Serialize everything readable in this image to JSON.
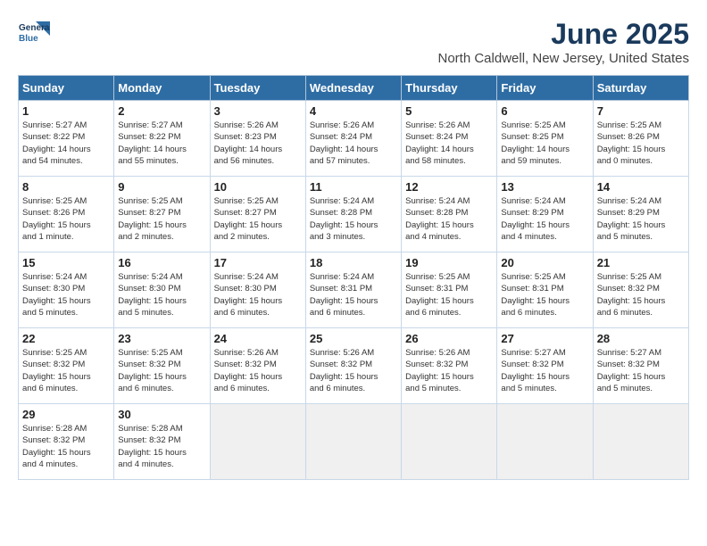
{
  "logo": {
    "line1": "General",
    "line2": "Blue"
  },
  "title": "June 2025",
  "location": "North Caldwell, New Jersey, United States",
  "headers": [
    "Sunday",
    "Monday",
    "Tuesday",
    "Wednesday",
    "Thursday",
    "Friday",
    "Saturday"
  ],
  "weeks": [
    [
      {
        "day": "1",
        "info": "Sunrise: 5:27 AM\nSunset: 8:22 PM\nDaylight: 14 hours\nand 54 minutes."
      },
      {
        "day": "2",
        "info": "Sunrise: 5:27 AM\nSunset: 8:22 PM\nDaylight: 14 hours\nand 55 minutes."
      },
      {
        "day": "3",
        "info": "Sunrise: 5:26 AM\nSunset: 8:23 PM\nDaylight: 14 hours\nand 56 minutes."
      },
      {
        "day": "4",
        "info": "Sunrise: 5:26 AM\nSunset: 8:24 PM\nDaylight: 14 hours\nand 57 minutes."
      },
      {
        "day": "5",
        "info": "Sunrise: 5:26 AM\nSunset: 8:24 PM\nDaylight: 14 hours\nand 58 minutes."
      },
      {
        "day": "6",
        "info": "Sunrise: 5:25 AM\nSunset: 8:25 PM\nDaylight: 14 hours\nand 59 minutes."
      },
      {
        "day": "7",
        "info": "Sunrise: 5:25 AM\nSunset: 8:26 PM\nDaylight: 15 hours\nand 0 minutes."
      }
    ],
    [
      {
        "day": "8",
        "info": "Sunrise: 5:25 AM\nSunset: 8:26 PM\nDaylight: 15 hours\nand 1 minute."
      },
      {
        "day": "9",
        "info": "Sunrise: 5:25 AM\nSunset: 8:27 PM\nDaylight: 15 hours\nand 2 minutes."
      },
      {
        "day": "10",
        "info": "Sunrise: 5:25 AM\nSunset: 8:27 PM\nDaylight: 15 hours\nand 2 minutes."
      },
      {
        "day": "11",
        "info": "Sunrise: 5:24 AM\nSunset: 8:28 PM\nDaylight: 15 hours\nand 3 minutes."
      },
      {
        "day": "12",
        "info": "Sunrise: 5:24 AM\nSunset: 8:28 PM\nDaylight: 15 hours\nand 4 minutes."
      },
      {
        "day": "13",
        "info": "Sunrise: 5:24 AM\nSunset: 8:29 PM\nDaylight: 15 hours\nand 4 minutes."
      },
      {
        "day": "14",
        "info": "Sunrise: 5:24 AM\nSunset: 8:29 PM\nDaylight: 15 hours\nand 5 minutes."
      }
    ],
    [
      {
        "day": "15",
        "info": "Sunrise: 5:24 AM\nSunset: 8:30 PM\nDaylight: 15 hours\nand 5 minutes."
      },
      {
        "day": "16",
        "info": "Sunrise: 5:24 AM\nSunset: 8:30 PM\nDaylight: 15 hours\nand 5 minutes."
      },
      {
        "day": "17",
        "info": "Sunrise: 5:24 AM\nSunset: 8:30 PM\nDaylight: 15 hours\nand 6 minutes."
      },
      {
        "day": "18",
        "info": "Sunrise: 5:24 AM\nSunset: 8:31 PM\nDaylight: 15 hours\nand 6 minutes."
      },
      {
        "day": "19",
        "info": "Sunrise: 5:25 AM\nSunset: 8:31 PM\nDaylight: 15 hours\nand 6 minutes."
      },
      {
        "day": "20",
        "info": "Sunrise: 5:25 AM\nSunset: 8:31 PM\nDaylight: 15 hours\nand 6 minutes."
      },
      {
        "day": "21",
        "info": "Sunrise: 5:25 AM\nSunset: 8:32 PM\nDaylight: 15 hours\nand 6 minutes."
      }
    ],
    [
      {
        "day": "22",
        "info": "Sunrise: 5:25 AM\nSunset: 8:32 PM\nDaylight: 15 hours\nand 6 minutes."
      },
      {
        "day": "23",
        "info": "Sunrise: 5:25 AM\nSunset: 8:32 PM\nDaylight: 15 hours\nand 6 minutes."
      },
      {
        "day": "24",
        "info": "Sunrise: 5:26 AM\nSunset: 8:32 PM\nDaylight: 15 hours\nand 6 minutes."
      },
      {
        "day": "25",
        "info": "Sunrise: 5:26 AM\nSunset: 8:32 PM\nDaylight: 15 hours\nand 6 minutes."
      },
      {
        "day": "26",
        "info": "Sunrise: 5:26 AM\nSunset: 8:32 PM\nDaylight: 15 hours\nand 5 minutes."
      },
      {
        "day": "27",
        "info": "Sunrise: 5:27 AM\nSunset: 8:32 PM\nDaylight: 15 hours\nand 5 minutes."
      },
      {
        "day": "28",
        "info": "Sunrise: 5:27 AM\nSunset: 8:32 PM\nDaylight: 15 hours\nand 5 minutes."
      }
    ],
    [
      {
        "day": "29",
        "info": "Sunrise: 5:28 AM\nSunset: 8:32 PM\nDaylight: 15 hours\nand 4 minutes."
      },
      {
        "day": "30",
        "info": "Sunrise: 5:28 AM\nSunset: 8:32 PM\nDaylight: 15 hours\nand 4 minutes."
      },
      {
        "day": "",
        "info": ""
      },
      {
        "day": "",
        "info": ""
      },
      {
        "day": "",
        "info": ""
      },
      {
        "day": "",
        "info": ""
      },
      {
        "day": "",
        "info": ""
      }
    ]
  ]
}
